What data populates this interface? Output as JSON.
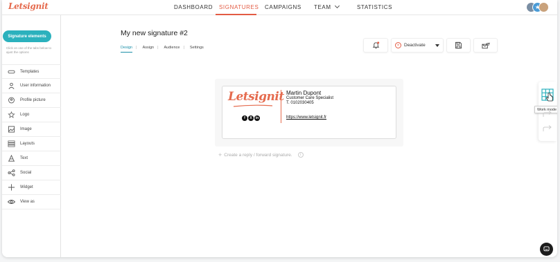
{
  "app": {
    "logo": "Letsignit"
  },
  "nav": {
    "items": [
      {
        "label": "DASHBOARD"
      },
      {
        "label": "SIGNATURES"
      },
      {
        "label": "CAMPAIGNS"
      },
      {
        "label": "TEAM"
      },
      {
        "label": "STATISTICS"
      }
    ],
    "active": "SIGNATURES"
  },
  "sidebar": {
    "pill": "Signature elements",
    "help": "Click on one of the tabs below to ajust the options",
    "items": [
      {
        "label": "Templates",
        "icon": "templates-icon"
      },
      {
        "label": "User information",
        "icon": "user-icon"
      },
      {
        "label": "Profile picture",
        "icon": "profile-picture-icon"
      },
      {
        "label": "Logo",
        "icon": "star-icon"
      },
      {
        "label": "Image",
        "icon": "image-icon"
      },
      {
        "label": "Layouts",
        "icon": "layouts-icon"
      },
      {
        "label": "Text",
        "icon": "text-icon"
      },
      {
        "label": "Social",
        "icon": "share-icon"
      },
      {
        "label": "Widget",
        "icon": "plus-icon"
      },
      {
        "label": "View as",
        "icon": "eye-icon"
      }
    ]
  },
  "main": {
    "title": "My new signature #2",
    "tabs": [
      {
        "label": "Design"
      },
      {
        "label": "Assign"
      },
      {
        "label": "Audience"
      },
      {
        "label": "Settings"
      }
    ],
    "active_tab": "Design",
    "toolbar": {
      "deactivate_label": "Deactivate"
    }
  },
  "signature": {
    "logo_text": "Letsignit",
    "name": "Martin Dupont",
    "role": "Customer Care Specialist",
    "phone": "T. 0102030405",
    "link": "https://www.letsignit.fr",
    "social": [
      "f",
      "X",
      "in"
    ]
  },
  "reply": {
    "label": "Create a reply / forward signature."
  },
  "rail": {
    "tooltip": "Work mode"
  },
  "colors": {
    "brand": "#e35b43",
    "accent": "#2bb1bd",
    "link_active": "#1b8fa8"
  }
}
